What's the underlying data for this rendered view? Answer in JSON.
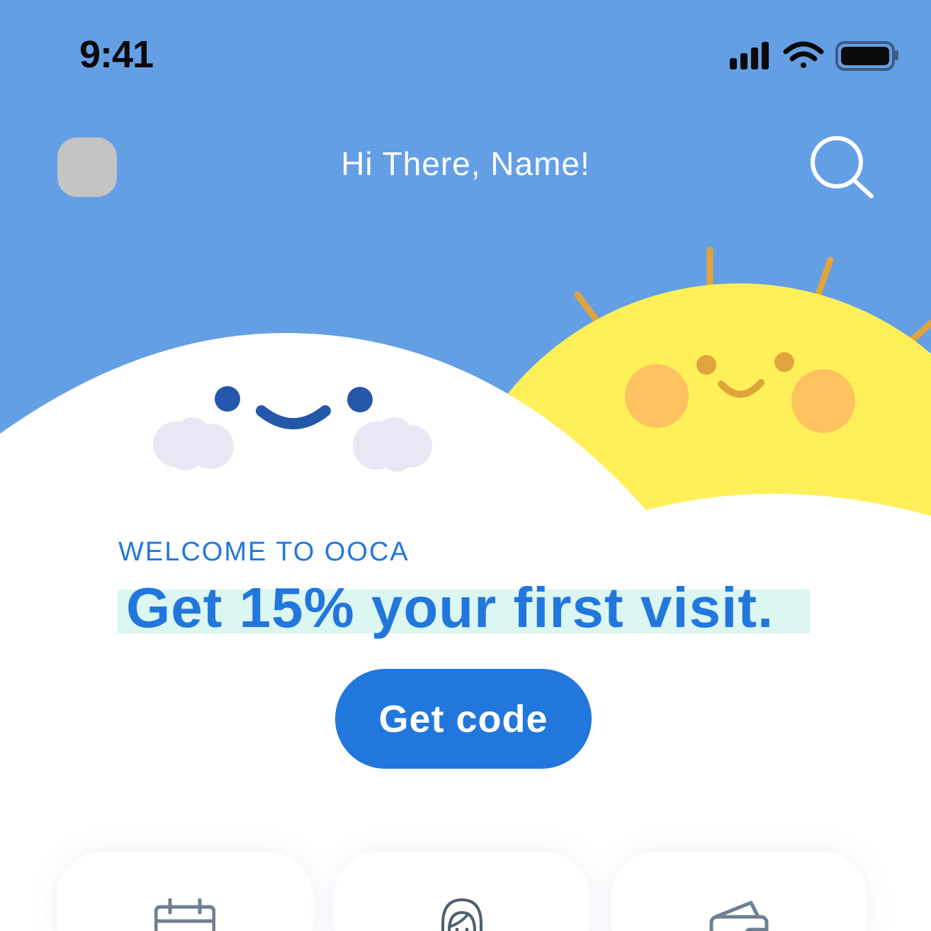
{
  "status_bar": {
    "time": "9:41",
    "icons": [
      "cellular-signal-icon",
      "wifi-icon",
      "battery-icon"
    ]
  },
  "header": {
    "greeting": "Hi There, Name!",
    "avatar": "avatar-placeholder",
    "search_icon": "search-icon"
  },
  "hero": {
    "illustrations": [
      "smiling-cloud",
      "smiling-sun"
    ],
    "welcome_label": "WELCOME TO OOCA",
    "promo_title": "Get 15% your first visit.",
    "cta_label": "Get code"
  },
  "services": [
    {
      "icon": "calendar-icon"
    },
    {
      "icon": "therapist-icon"
    },
    {
      "icon": "wallet-icon"
    }
  ],
  "colors": {
    "sky": "#649fe6",
    "primary": "#2277dd",
    "sun": "#fff05a",
    "sun_rays": "#e0a43a",
    "cheeks": "#ffc260",
    "cloud": "#ffffff",
    "highlight": "#dcf6f1"
  }
}
